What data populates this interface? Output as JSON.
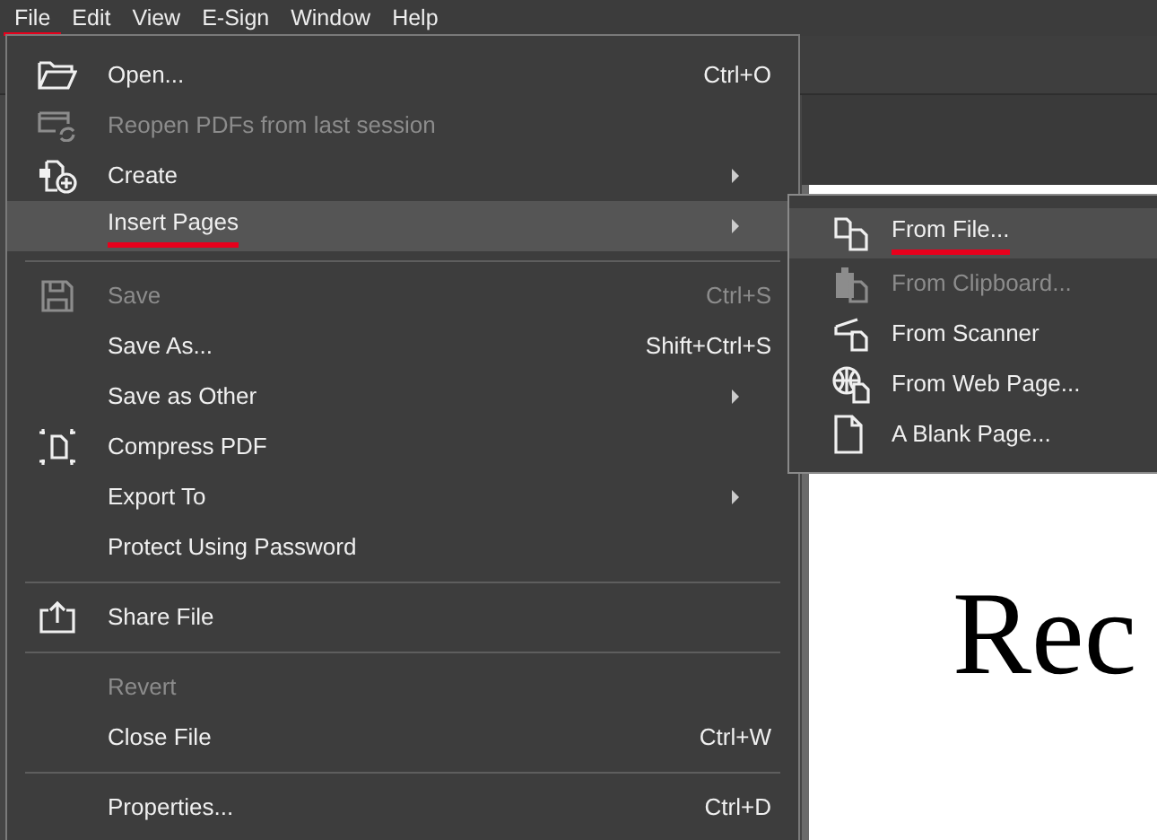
{
  "menubar": [
    {
      "label": "File",
      "selected": true
    },
    {
      "label": "Edit",
      "selected": false
    },
    {
      "label": "View",
      "selected": false
    },
    {
      "label": "E-Sign",
      "selected": false
    },
    {
      "label": "Window",
      "selected": false
    },
    {
      "label": "Help",
      "selected": false
    }
  ],
  "file_menu": [
    {
      "kind": "item",
      "label": "Open...",
      "shortcut": "Ctrl+O",
      "disabled": false,
      "selected": false,
      "marked": false,
      "submenu": false
    },
    {
      "kind": "item",
      "label": "Reopen PDFs from last session",
      "disabled": true,
      "selected": false,
      "marked": false,
      "submenu": false
    },
    {
      "kind": "item",
      "label": "Create",
      "disabled": false,
      "selected": false,
      "marked": false,
      "submenu": true
    },
    {
      "kind": "item",
      "label": "Insert Pages",
      "disabled": false,
      "selected": true,
      "marked": true,
      "submenu": true
    },
    {
      "kind": "separator"
    },
    {
      "kind": "item",
      "label": "Save",
      "shortcut": "Ctrl+S",
      "disabled": true,
      "selected": false,
      "marked": false,
      "submenu": false
    },
    {
      "kind": "item",
      "label": "Save As...",
      "shortcut": "Shift+Ctrl+S",
      "disabled": false,
      "selected": false,
      "marked": false,
      "submenu": false
    },
    {
      "kind": "item",
      "label": "Save as Other",
      "disabled": false,
      "selected": false,
      "marked": false,
      "submenu": true
    },
    {
      "kind": "item",
      "label": "Compress PDF",
      "disabled": false,
      "selected": false,
      "marked": false,
      "submenu": false
    },
    {
      "kind": "item",
      "label": "Export To",
      "disabled": false,
      "selected": false,
      "marked": false,
      "submenu": true
    },
    {
      "kind": "item",
      "label": "Protect Using Password",
      "disabled": false,
      "selected": false,
      "marked": false,
      "submenu": false
    },
    {
      "kind": "separator"
    },
    {
      "kind": "item",
      "label": "Share File",
      "disabled": false,
      "selected": false,
      "marked": false,
      "submenu": false
    },
    {
      "kind": "separator"
    },
    {
      "kind": "item",
      "label": "Revert",
      "disabled": true,
      "selected": false,
      "marked": false,
      "submenu": false
    },
    {
      "kind": "item",
      "label": "Close File",
      "shortcut": "Ctrl+W",
      "disabled": false,
      "selected": false,
      "marked": false,
      "submenu": false
    },
    {
      "kind": "separator"
    },
    {
      "kind": "item",
      "label": "Properties...",
      "shortcut": "Ctrl+D",
      "disabled": false,
      "selected": false,
      "marked": false,
      "submenu": false
    }
  ],
  "insert_pages_submenu": [
    {
      "label": "From File...",
      "disabled": false,
      "selected": true,
      "marked": true
    },
    {
      "label": "From Clipboard...",
      "disabled": true,
      "selected": false,
      "marked": false
    },
    {
      "label": "From Scanner",
      "disabled": false,
      "selected": false,
      "marked": false
    },
    {
      "label": "From Web Page...",
      "disabled": false,
      "selected": false,
      "marked": false
    },
    {
      "label": "A Blank Page...",
      "disabled": false,
      "selected": false,
      "marked": false
    }
  ],
  "document": {
    "heading": "Rec"
  }
}
